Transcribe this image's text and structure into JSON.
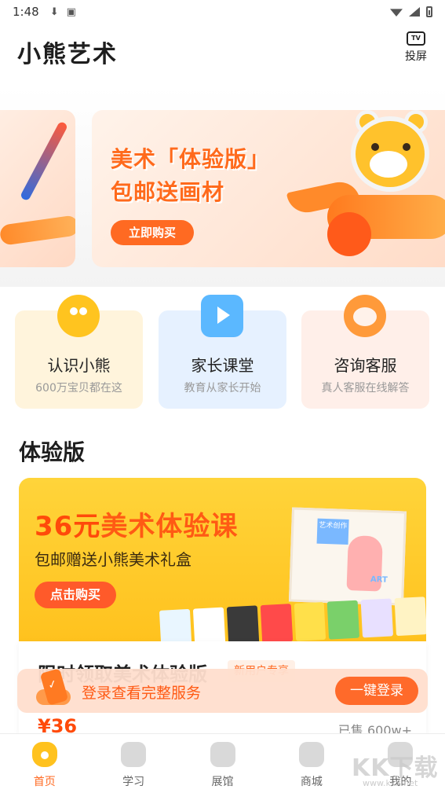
{
  "status_bar": {
    "time": "1:48",
    "icons": [
      "download-icon",
      "a-icon",
      "wifi-icon",
      "signal-icon",
      "battery-icon"
    ]
  },
  "header": {
    "title": "小熊艺术",
    "cast_label": "投屏",
    "cast_icon_text": "TV"
  },
  "banner": {
    "line1": "美术「体验版」",
    "line2": "包邮送画材",
    "button": "立即购买"
  },
  "quick_links": [
    {
      "title": "认识小熊",
      "subtitle": "600万宝贝都在这",
      "icon": "bear-icon"
    },
    {
      "title": "家长课堂",
      "subtitle": "教育从家长开始",
      "icon": "play-icon"
    },
    {
      "title": "咨询客服",
      "subtitle": "真人客服在线解答",
      "icon": "headset-icon"
    }
  ],
  "section": {
    "title": "体验版"
  },
  "promo": {
    "title_price": "36元",
    "title_rest": "美术体验课",
    "subtitle": "包邮赠送小熊美术礼盒",
    "button": "点击购买",
    "box_label": "艺术创作",
    "box_label_en": "ART"
  },
  "promo_info": {
    "title": "限时领取美术体验版",
    "tag": "新用户专享",
    "price": "¥36",
    "sold": "已售 600w+"
  },
  "login_bar": {
    "text": "登录查看完整服务",
    "button": "一键登录"
  },
  "tabs": [
    {
      "label": "首页",
      "active": true
    },
    {
      "label": "学习",
      "active": false
    },
    {
      "label": "展馆",
      "active": false
    },
    {
      "label": "商城",
      "active": false
    },
    {
      "label": "我的",
      "active": false
    }
  ],
  "watermark": {
    "main": "KK下载",
    "sub": "www.kkx.net"
  },
  "colors": {
    "accent": "#ff6a22",
    "promo_yellow": "#ffc21e",
    "text_dark": "#1e1e1e"
  }
}
